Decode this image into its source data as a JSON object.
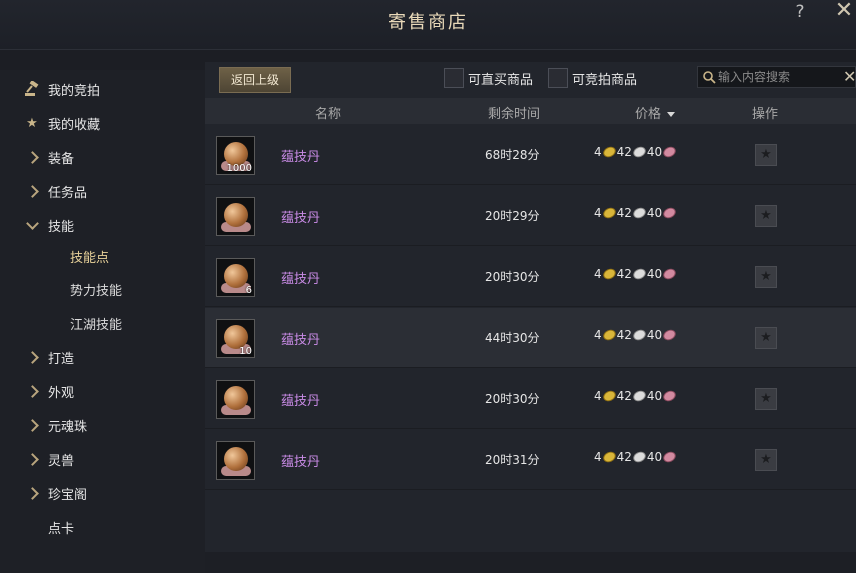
{
  "window": {
    "title": "寄售商店",
    "help": "?",
    "close": "✕"
  },
  "sidebar": {
    "items": [
      {
        "label": "我的竞拍",
        "icon": "gavel-icon",
        "type": "top",
        "y": 0
      },
      {
        "label": "我的收藏",
        "icon": "star-icon",
        "type": "top"
      },
      {
        "label": "装备",
        "icon": "chevron-right-icon",
        "type": "cat"
      },
      {
        "label": "任务品",
        "icon": "chevron-right-icon",
        "type": "cat"
      },
      {
        "label": "技能",
        "icon": "chevron-down-icon",
        "type": "cat"
      },
      {
        "label": "技能点",
        "type": "sub",
        "active": true
      },
      {
        "label": "势力技能",
        "type": "sub"
      },
      {
        "label": "江湖技能",
        "type": "sub"
      },
      {
        "label": "打造",
        "icon": "chevron-right-icon",
        "type": "cat"
      },
      {
        "label": "外观",
        "icon": "chevron-right-icon",
        "type": "cat"
      },
      {
        "label": "元魂珠",
        "icon": "chevron-right-icon",
        "type": "cat"
      },
      {
        "label": "灵兽",
        "icon": "chevron-right-icon",
        "type": "cat"
      },
      {
        "label": "珍宝阁",
        "icon": "chevron-right-icon",
        "type": "cat"
      },
      {
        "label": "点卡",
        "type": "cat"
      }
    ]
  },
  "toolbar": {
    "back_label": "返回上级",
    "filter_buy_now": "可直买商品",
    "filter_auction": "可竞拍商品",
    "search_placeholder": "输入内容搜索"
  },
  "table": {
    "headers": {
      "name": "名称",
      "time": "剩余时间",
      "price": "价格",
      "action": "操作"
    },
    "rows": [
      {
        "name": "蕴技丹",
        "qty": "1000",
        "time": "68时28分",
        "gold": "4",
        "silver": "42",
        "copper": "40",
        "highlight": false
      },
      {
        "name": "蕴技丹",
        "qty": "",
        "time": "20时29分",
        "gold": "4",
        "silver": "42",
        "copper": "40",
        "highlight": false
      },
      {
        "name": "蕴技丹",
        "qty": "6",
        "time": "20时30分",
        "gold": "4",
        "silver": "42",
        "copper": "40",
        "highlight": false
      },
      {
        "name": "蕴技丹",
        "qty": "10",
        "time": "44时30分",
        "gold": "4",
        "silver": "42",
        "copper": "40",
        "highlight": true
      },
      {
        "name": "蕴技丹",
        "qty": "",
        "time": "20时30分",
        "gold": "4",
        "silver": "42",
        "copper": "40",
        "highlight": false
      },
      {
        "name": "蕴技丹",
        "qty": "",
        "time": "20时31分",
        "gold": "4",
        "silver": "42",
        "copper": "40",
        "highlight": false
      }
    ]
  }
}
